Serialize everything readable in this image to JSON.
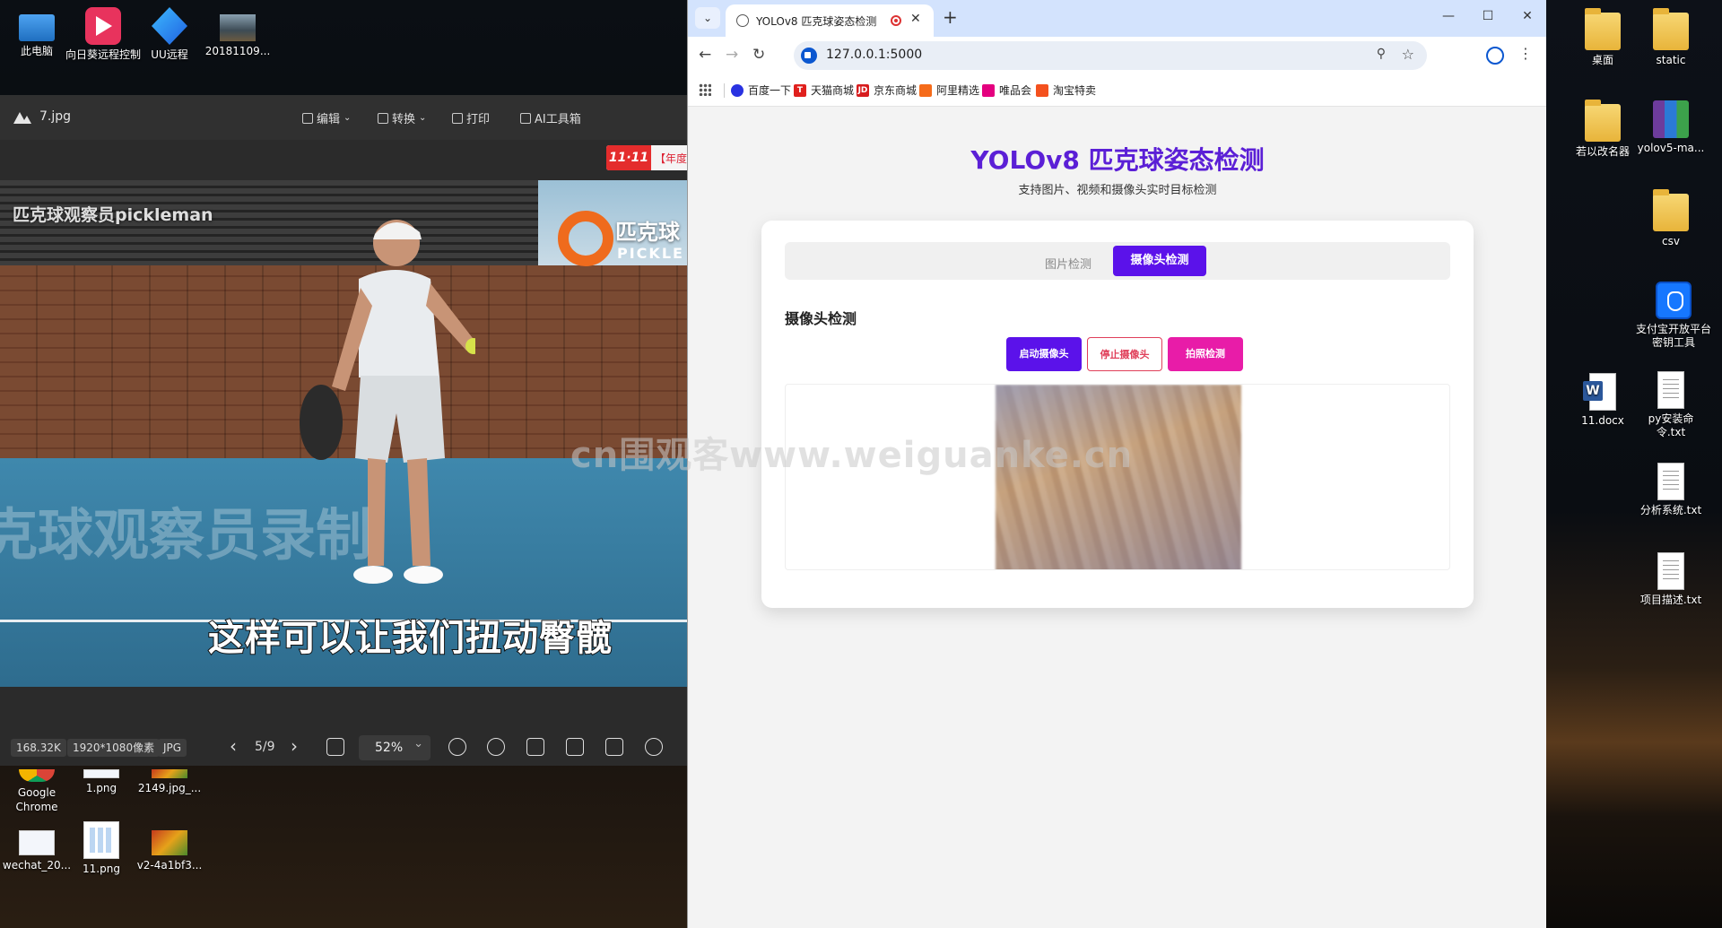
{
  "desktop": {
    "left_icons": [
      {
        "label": "此电脑",
        "icon": "pc-icon"
      },
      {
        "label": "向日葵远程控制",
        "icon": "sunlogin-icon"
      },
      {
        "label": "UU远程",
        "icon": "uu-icon"
      },
      {
        "label": "20181109...",
        "icon": "photo-icon"
      }
    ],
    "bottom_icons": [
      {
        "label": "Google Chrome",
        "icon": "chrome-icon"
      },
      {
        "label": "1.png",
        "icon": "image-icon"
      },
      {
        "label": "2149.jpg_...",
        "icon": "image-icon"
      },
      {
        "label": "wechat_20...",
        "icon": "image-icon"
      },
      {
        "label": "11.png",
        "icon": "image-icon"
      },
      {
        "label": "v2-4a1bf3...",
        "icon": "image-icon"
      }
    ],
    "right_icons": [
      {
        "label": "桌面",
        "icon": "folder-icon"
      },
      {
        "label": "static",
        "icon": "folder-icon"
      },
      {
        "label": "若以改名器",
        "icon": "folder-icon"
      },
      {
        "label": "yolov5-ma...",
        "icon": "winrar-icon"
      },
      {
        "label": "csv",
        "icon": "folder-icon"
      },
      {
        "label": "支付宝开放平台密钥工具",
        "icon": "alipay-icon"
      },
      {
        "label": "11.docx",
        "icon": "word-icon"
      },
      {
        "label": "py安装命令.txt",
        "icon": "text-file-icon"
      },
      {
        "label": "分析系统.txt",
        "icon": "text-file-icon"
      },
      {
        "label": "项目描述.txt",
        "icon": "text-file-icon"
      }
    ]
  },
  "viewer": {
    "filename": "7.jpg",
    "menu": {
      "edit": "编辑",
      "convert": "转换",
      "print": "打印",
      "ai_tools": "AI工具箱"
    },
    "promo": {
      "badge": "11·11",
      "text": "【年度"
    },
    "image_text": {
      "watermark_top": "匹克球观察员pickleman",
      "logo_text": "匹克球",
      "logo_sub": "PICKLE",
      "big_watermark": "克球观察员录制",
      "subtitle": "这样可以让我们扭动臀髋"
    },
    "info": {
      "size": "168.32K",
      "resolution": "1920*1080像素",
      "format": "JPG"
    },
    "pages": "5/9",
    "zoom": "52%"
  },
  "browser": {
    "tab_title": "YOLOv8 匹克球姿态检测",
    "url": "127.0.0.1:5000",
    "bookmarks": [
      {
        "label": "百度一下",
        "color": "#2932e1"
      },
      {
        "label": "天猫商城",
        "color": "#e0201d"
      },
      {
        "label": "京东商城",
        "color": "#d71c1e"
      },
      {
        "label": "阿里精选",
        "color": "#f56b1a"
      },
      {
        "label": "唯品会",
        "color": "#e4007f"
      },
      {
        "label": "淘宝特卖",
        "color": "#f4511e"
      }
    ]
  },
  "app": {
    "title": "YOLOv8 匹克球姿态检测",
    "subtitle": "支持图片、视频和摄像头实时目标检测",
    "tabs": {
      "image": "图片检测",
      "camera": "摄像头检测"
    },
    "section_title": "摄像头检测",
    "buttons": {
      "start": "启动摄像头",
      "stop": "停止摄像头",
      "capture": "拍照检测"
    },
    "accent_color": "#5b12ea"
  },
  "overlay_watermark": "cn围观客www.weiguanke.cn"
}
